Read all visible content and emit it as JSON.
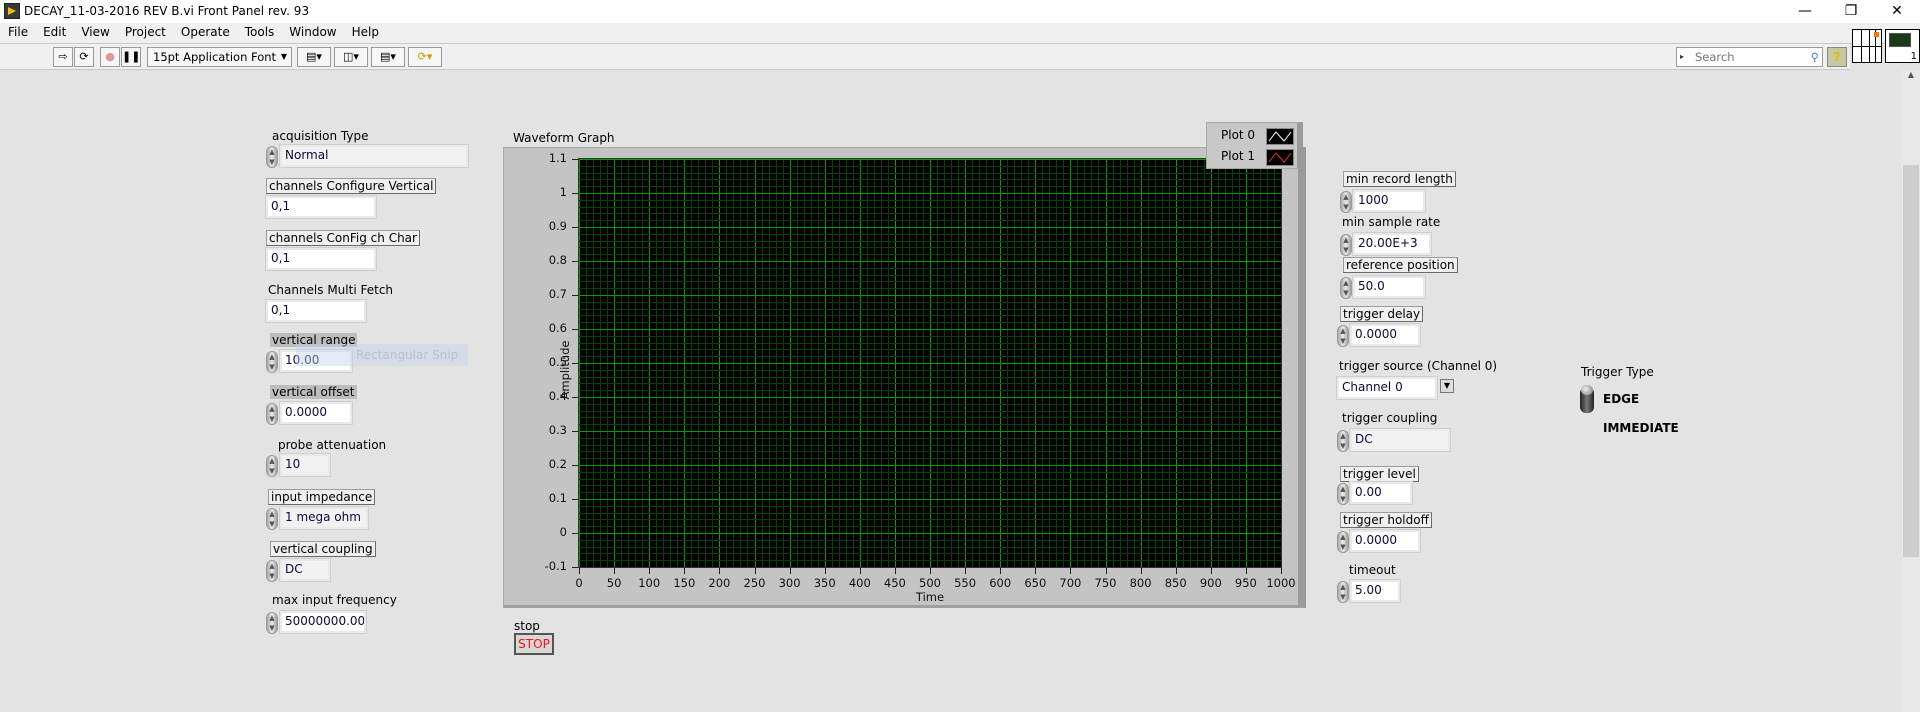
{
  "window": {
    "title": "DECAY_11-03-2016 REV B.vi Front Panel rev. 93",
    "controls": [
      "minimize",
      "restore",
      "close"
    ]
  },
  "menu": [
    "File",
    "Edit",
    "View",
    "Project",
    "Operate",
    "Tools",
    "Window",
    "Help"
  ],
  "toolbar": {
    "font": "15pt Application Font",
    "search_placeholder": "Search",
    "buttons": [
      "run-arrow",
      "run-continuously",
      "abort",
      "pause",
      "align-objects",
      "distribute-objects",
      "resize-objects",
      "reorder"
    ]
  },
  "left": {
    "acquisition_type": {
      "label": "acquisition Type",
      "value": "Normal"
    },
    "channels_configure_vertical": {
      "label": "channels Configure Vertical",
      "value": "0,1"
    },
    "channels_config_ch_char": {
      "label": "channels ConFig ch Char",
      "value": "0,1"
    },
    "channels_multi_fetch": {
      "label": "Channels Multi Fetch",
      "value": "0,1"
    },
    "vertical_range": {
      "label": "vertical range",
      "value": "10.00"
    },
    "vertical_offset": {
      "label": "vertical offset",
      "value": "0.0000"
    },
    "probe_attenuation": {
      "label": "probe attenuation",
      "value": "10"
    },
    "input_impedance": {
      "label": "input impedance",
      "value": "1 mega ohm"
    },
    "vertical_coupling": {
      "label": "vertical coupling",
      "value": "DC"
    },
    "max_input_frequency": {
      "label": "max input frequency",
      "value": "50000000.00"
    }
  },
  "snip_overlay": "Rectangular Snip",
  "stop": {
    "label": "stop",
    "button": "STOP"
  },
  "right": {
    "min_record_length": {
      "label": "min record length",
      "value": "1000"
    },
    "min_sample_rate": {
      "label": "min sample rate",
      "value": "20.00E+3"
    },
    "reference_position": {
      "label": "reference position",
      "value": "50.0"
    },
    "trigger_delay": {
      "label": "trigger delay",
      "value": "0.0000"
    },
    "trigger_source": {
      "label": "trigger source (Channel 0)",
      "value": "Channel 0"
    },
    "trigger_coupling": {
      "label": "trigger coupling",
      "value": "DC"
    },
    "trigger_level": {
      "label": "trigger level",
      "value": "0.00"
    },
    "trigger_holdoff": {
      "label": "trigger holdoff",
      "value": "0.0000"
    },
    "timeout": {
      "label": "timeout",
      "value": "5.00"
    }
  },
  "trigger_type": {
    "label": "Trigger Type",
    "options": [
      "EDGE",
      "IMMEDIATE"
    ],
    "selected": "EDGE"
  },
  "chart_data": {
    "type": "line",
    "title": "Waveform Graph",
    "xlabel": "Time",
    "ylabel": "Amplitude",
    "xlim": [
      0,
      1000
    ],
    "ylim": [
      -0.1,
      1.1
    ],
    "xticks": [
      "0",
      "50",
      "100",
      "150",
      "200",
      "250",
      "300",
      "350",
      "400",
      "450",
      "500",
      "550",
      "600",
      "650",
      "700",
      "750",
      "800",
      "850",
      "900",
      "950",
      "1000"
    ],
    "yticks": [
      "-0.1",
      "0",
      "0.1",
      "0.2",
      "0.3",
      "0.4",
      "0.5",
      "0.6",
      "0.7",
      "0.8",
      "0.9",
      "1",
      "1.1"
    ],
    "grid": true,
    "legend": "top-right",
    "series": [
      {
        "name": "Plot 0",
        "color": "#ffffff",
        "values": []
      },
      {
        "name": "Plot 1",
        "color": "#ff2020",
        "values": []
      }
    ],
    "colors": {
      "background": "#000000",
      "grid_major": "#00a000",
      "grid_minor": "#004400"
    }
  }
}
